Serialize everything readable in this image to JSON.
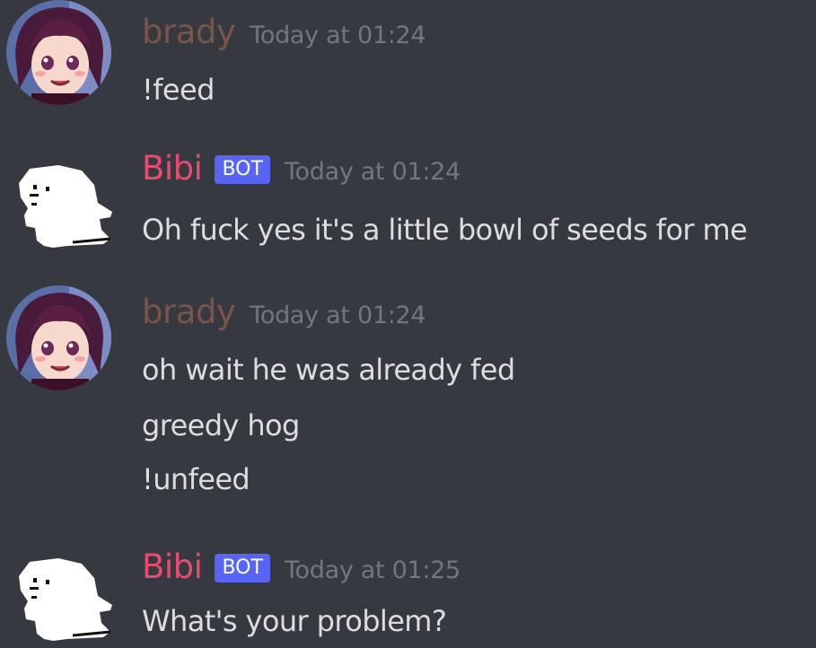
{
  "messages": [
    {
      "author": "brady",
      "timestamp": "Today at 01:24",
      "lines": [
        "!feed"
      ]
    },
    {
      "author": "Bibi",
      "bot_tag": "BOT",
      "timestamp": "Today at 01:24",
      "lines": [
        "Oh fuck yes it's a little bowl of seeds for me"
      ]
    },
    {
      "author": "brady",
      "timestamp": "Today at 01:24",
      "lines": [
        "oh wait he was already fed",
        "greedy hog",
        "!unfeed"
      ]
    },
    {
      "author": "Bibi",
      "bot_tag": "BOT",
      "timestamp": "Today at 01:25",
      "lines": [
        "What's your problem?"
      ]
    }
  ],
  "colors": {
    "background": "#36393f",
    "brady_name": "#795548",
    "bibi_name": "#e84b72",
    "bot_tag": "#5865f2",
    "timestamp": "#72767d",
    "message_text": "#dcddde"
  },
  "icons": {
    "brady_avatar": "anime-girl-avatar-icon",
    "bibi_avatar": "ghost-avatar-icon"
  }
}
